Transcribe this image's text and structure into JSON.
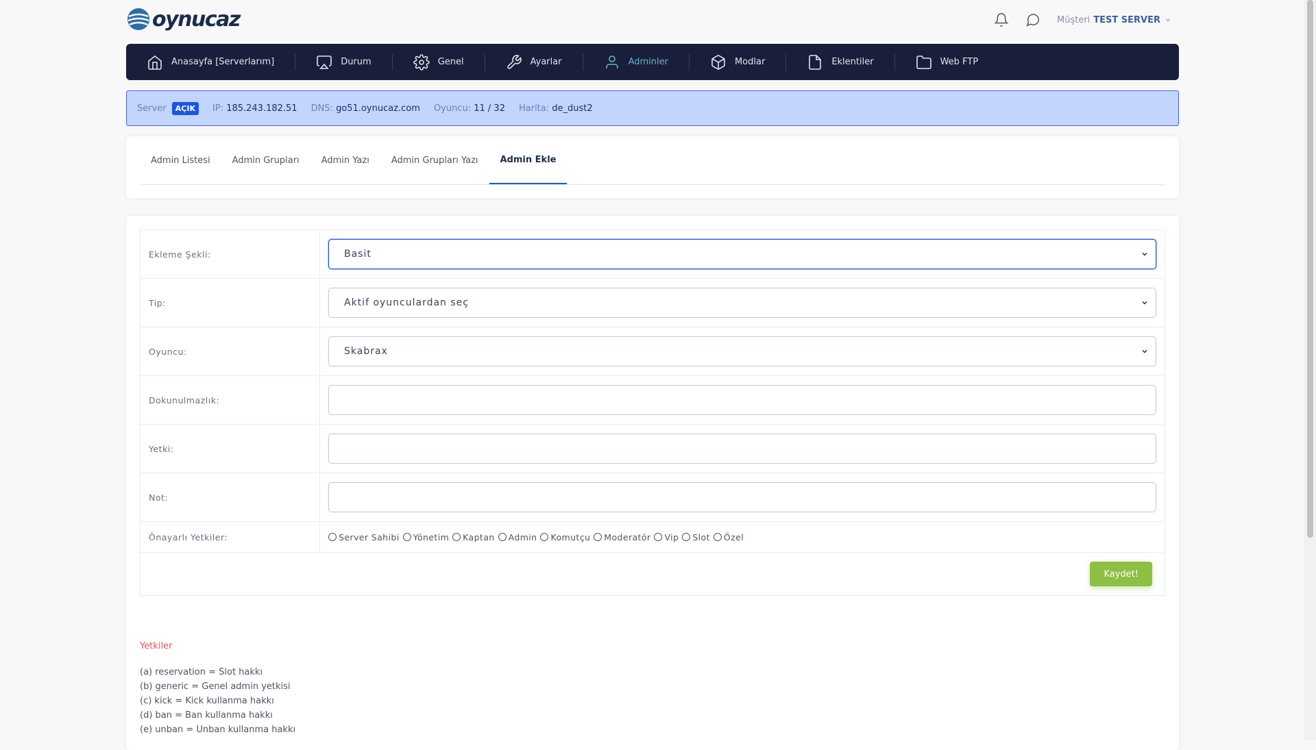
{
  "brand": {
    "name": "oynucaz"
  },
  "header": {
    "customer_label": "Müşteri",
    "customer_name": "TEST SERVER"
  },
  "nav": [
    {
      "label": "Anasayfa [Serverlarım]",
      "icon": "home-icon"
    },
    {
      "label": "Durum",
      "icon": "monitor-icon"
    },
    {
      "label": "Genel",
      "icon": "settings-icon"
    },
    {
      "label": "Ayarlar",
      "icon": "wrench-icon"
    },
    {
      "label": "Adminler",
      "icon": "user-icon",
      "active": true
    },
    {
      "label": "Modlar",
      "icon": "package-icon"
    },
    {
      "label": "Eklentiler",
      "icon": "file-icon"
    },
    {
      "label": "Web FTP",
      "icon": "folder-icon"
    }
  ],
  "server": {
    "server_label": "Server",
    "status": "AÇIK",
    "ip_label": "IP:",
    "ip": "185.243.182.51",
    "dns_label": "DNS:",
    "dns": "go51.oynucaz.com",
    "players_label": "Oyuncu:",
    "players": "11 / 32",
    "map_label": "Harita:",
    "map": "de_dust2"
  },
  "tabs": [
    {
      "label": "Admin Listesi"
    },
    {
      "label": "Admin Grupları"
    },
    {
      "label": "Admin Yazı"
    },
    {
      "label": "Admin Grupları Yazı"
    },
    {
      "label": "Admin Ekle",
      "active": true
    }
  ],
  "form": {
    "method_label": "Ekleme Şekli:",
    "method_value": "Basit",
    "type_label": "Tip:",
    "type_value": "Aktif oyunculardan seç",
    "player_label": "Oyuncu:",
    "player_value": "Skabrax",
    "immunity_label": "Dokunulmazlık:",
    "immunity_value": "",
    "flags_label": "Yetki:",
    "flags_value": "",
    "note_label": "Not:",
    "note_value": "",
    "preset_label": "Önayarlı Yetkiler:",
    "presets": [
      "Server Sahibi",
      "Yönetim",
      "Kaptan",
      "Admin",
      "Komutçu",
      "Moderatör",
      "Vip",
      "Slot",
      "Özel"
    ],
    "save_label": "Kaydet!"
  },
  "permissions": {
    "title": "Yetkiler",
    "items": [
      "(a) reservation = Slot hakkı",
      "(b) generic = Genel admin yetkisi",
      "(c) kick = Kick kullanma hakkı",
      "(d) ban = Ban kullanma hakkı",
      "(e) unban = Unban kullanma hakkı"
    ]
  },
  "colors": {
    "nav_bg": "#191e3a",
    "accent": "#1b55e2",
    "active_nav": "#61b6cd",
    "info_bg": "#c2d5ff",
    "save": "#8dbf42",
    "permission_title": "#e7515a"
  }
}
